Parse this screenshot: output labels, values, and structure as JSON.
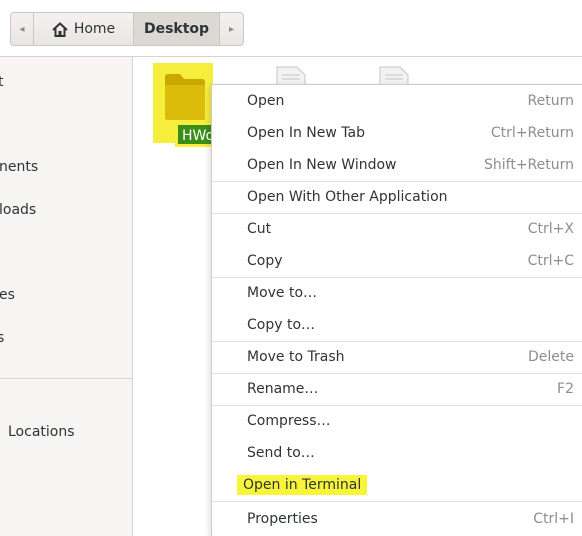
{
  "pathbar": {
    "back_arrow": "◂",
    "home_label": "Home",
    "desktop_label": "Desktop",
    "forward_arrow": "▸"
  },
  "sidebar": {
    "items": [
      {
        "label": "t"
      },
      {
        "label": "nents"
      },
      {
        "label": "loads"
      },
      {
        "label": "es"
      },
      {
        "label": "s"
      },
      {
        "label": "Locations"
      }
    ]
  },
  "content": {
    "folder_label": "HWorld",
    "highlight_color": "#f5ee3d"
  },
  "context_menu": {
    "items": [
      {
        "label": "Open",
        "accel": "Return"
      },
      {
        "label": "Open In New Tab",
        "accel": "Ctrl+Return"
      },
      {
        "label": "Open In New Window",
        "accel": "Shift+Return"
      },
      {
        "label": "Open With Other Application",
        "accel": ""
      },
      {
        "label": "Cut",
        "accel": "Ctrl+X"
      },
      {
        "label": "Copy",
        "accel": "Ctrl+C"
      },
      {
        "label": "Move to…",
        "accel": ""
      },
      {
        "label": "Copy to…",
        "accel": ""
      },
      {
        "label": "Move to Trash",
        "accel": "Delete"
      },
      {
        "label": "Rename…",
        "accel": "F2"
      },
      {
        "label": "Compress…",
        "accel": ""
      },
      {
        "label": "Send to…",
        "accel": ""
      },
      {
        "label": "Open in Terminal",
        "accel": ""
      },
      {
        "label": "Properties",
        "accel": "Ctrl+I"
      }
    ]
  }
}
